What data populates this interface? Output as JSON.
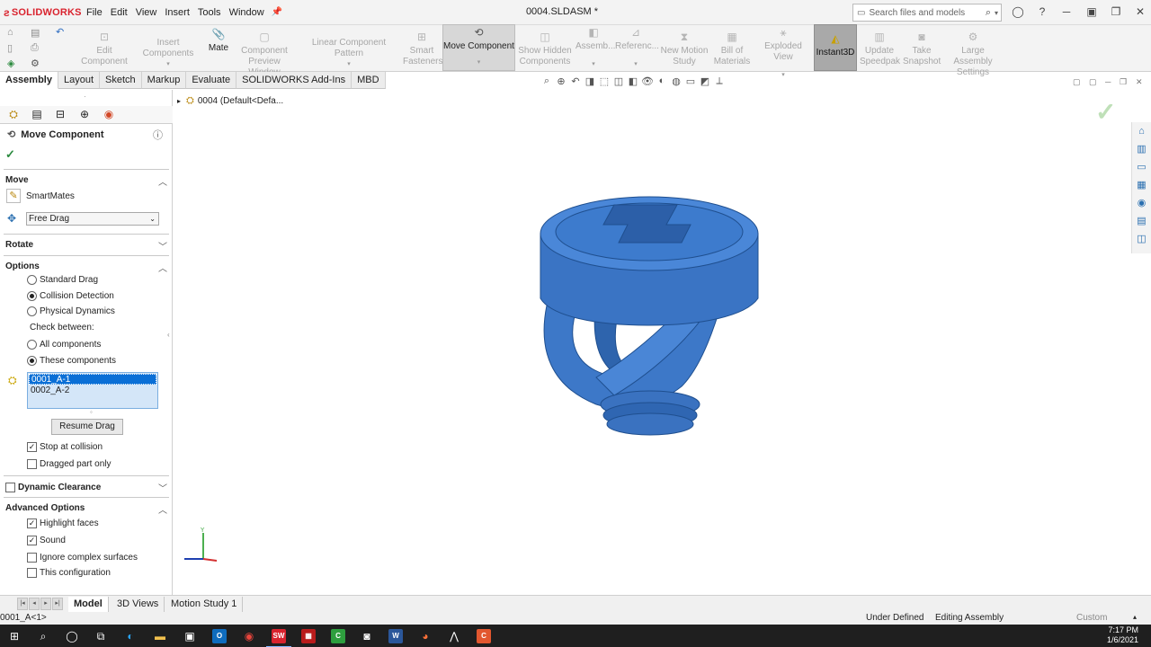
{
  "app": {
    "logo": "SOLIDWORKS",
    "menu": [
      "File",
      "Edit",
      "View",
      "Insert",
      "Tools",
      "Window"
    ],
    "document_title": "0004.SLDASM *",
    "search_placeholder": "Search files and models"
  },
  "commands": {
    "edit_component": "Edit Component",
    "insert_components": "Insert Components",
    "mate": "Mate",
    "component_preview_window": "Component Preview Window",
    "linear_component_pattern": "Linear Component Pattern",
    "smart_fasteners": "Smart Fasteners",
    "move_component": "Move Component",
    "show_hidden_components": "Show Hidden Components",
    "assembly_features": "Assemb...",
    "reference_geometry": "Referenc...",
    "new_motion_study": "New Motion Study",
    "bill_of_materials": "Bill of Materials",
    "exploded_view": "Exploded View",
    "instant3d": "Instant3D",
    "update_speedpak": "Update Speedpak",
    "take_snapshot": "Take Snapshot",
    "large_assembly_settings": "Large Assembly Settings"
  },
  "tabs": [
    "Assembly",
    "Layout",
    "Sketch",
    "Markup",
    "Evaluate",
    "SOLIDWORKS Add-Ins",
    "MBD"
  ],
  "property_manager": {
    "title": "Move Component",
    "move": {
      "heading": "Move",
      "smartmates": "SmartMates",
      "drag_mode": "Free Drag"
    },
    "rotate": {
      "heading": "Rotate"
    },
    "options": {
      "heading": "Options",
      "standard_drag": "Standard Drag",
      "collision_detection": "Collision Detection",
      "physical_dynamics": "Physical Dynamics",
      "check_between": "Check between:",
      "all_components": "All components",
      "these_components": "These components",
      "components": [
        "0001_A-1",
        "0002_A-2"
      ],
      "resume_drag": "Resume Drag",
      "stop_at_collision": "Stop at collision",
      "dragged_part_only": "Dragged part only"
    },
    "dynamic_clearance": {
      "heading": "Dynamic Clearance"
    },
    "advanced": {
      "heading": "Advanced Options",
      "highlight_faces": "Highlight faces",
      "sound": "Sound",
      "ignore_complex_surfaces": "Ignore complex surfaces",
      "this_configuration": "This configuration"
    }
  },
  "tree": {
    "label": "0004  (Default<Defa..."
  },
  "triad": {
    "y": "Y"
  },
  "bottom_tabs": [
    "Model",
    "3D Views",
    "Motion Study 1"
  ],
  "status": {
    "left": "0001_A<1>",
    "definition": "Under Defined",
    "mode": "Editing Assembly",
    "units": "Custom"
  },
  "clock": {
    "time": "7:17 PM",
    "date": "1/6/2021"
  },
  "colors": {
    "model_blue": "#3d78c8",
    "accent_blue": "#0a6fd6",
    "logo_red": "#d9232e"
  }
}
